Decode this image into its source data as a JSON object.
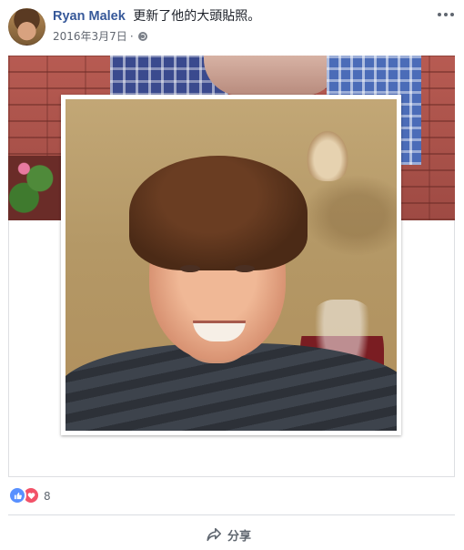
{
  "post": {
    "author": "Ryan Malek",
    "action": "更新了他的大頭貼照。",
    "date": "2016年3月7日",
    "separator": "·",
    "privacy_icon": "globe-icon",
    "menu_icon": "more-options-icon"
  },
  "reactions": {
    "types": [
      "like",
      "love"
    ],
    "count": "8"
  },
  "actions": {
    "share_label": "分享",
    "share_icon": "share-arrow-icon"
  },
  "colors": {
    "author_link": "#365899",
    "like_blue": "#5890ff",
    "love_red": "#f25268",
    "muted_text": "#606770"
  }
}
